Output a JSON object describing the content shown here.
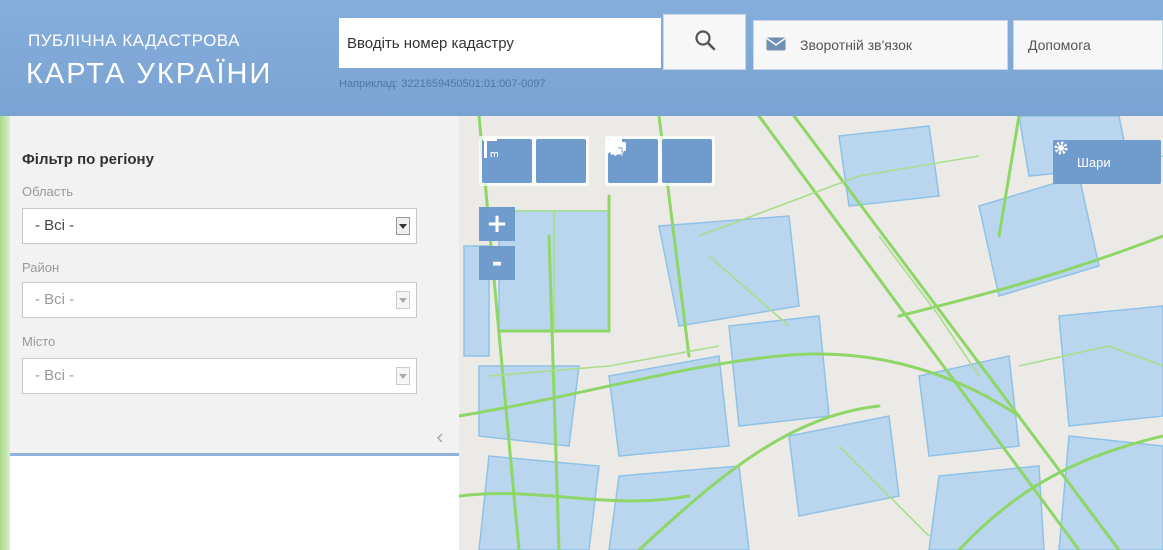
{
  "header": {
    "title_line1": "ПУБЛІЧНА КАДАСТРОВА",
    "title_line2": "КАРТА УКРАЇНИ",
    "search": {
      "placeholder": "Вводіть номер кадастру",
      "hint": "Наприклад: 3221659450501:01:007-0097"
    },
    "feedback_label": "Зворотній зв'язок",
    "help_label": "Допомога"
  },
  "filter": {
    "title": "Фільтр по регіону",
    "fields": [
      {
        "label": "Область",
        "value": "- Всі -",
        "enabled": true
      },
      {
        "label": "Район",
        "value": "- Всі -",
        "enabled": false
      },
      {
        "label": "Місто",
        "value": "- Всі -",
        "enabled": false
      }
    ]
  },
  "map": {
    "tools": [
      "ruler-icon",
      "area-measure-icon",
      "print-icon",
      "info-cursor-icon"
    ],
    "zoom_in_label": "+",
    "zoom_out_label": "-",
    "layers_label": "Шари"
  },
  "colors": {
    "header_bg": "#7ea8d8",
    "button_blue": "#6f9ccc",
    "map_bg": "#eceae6",
    "parcel_fill": "#b9d6ee",
    "parcel_stroke": "#8fc2e6",
    "road_green": "#8ed667"
  }
}
